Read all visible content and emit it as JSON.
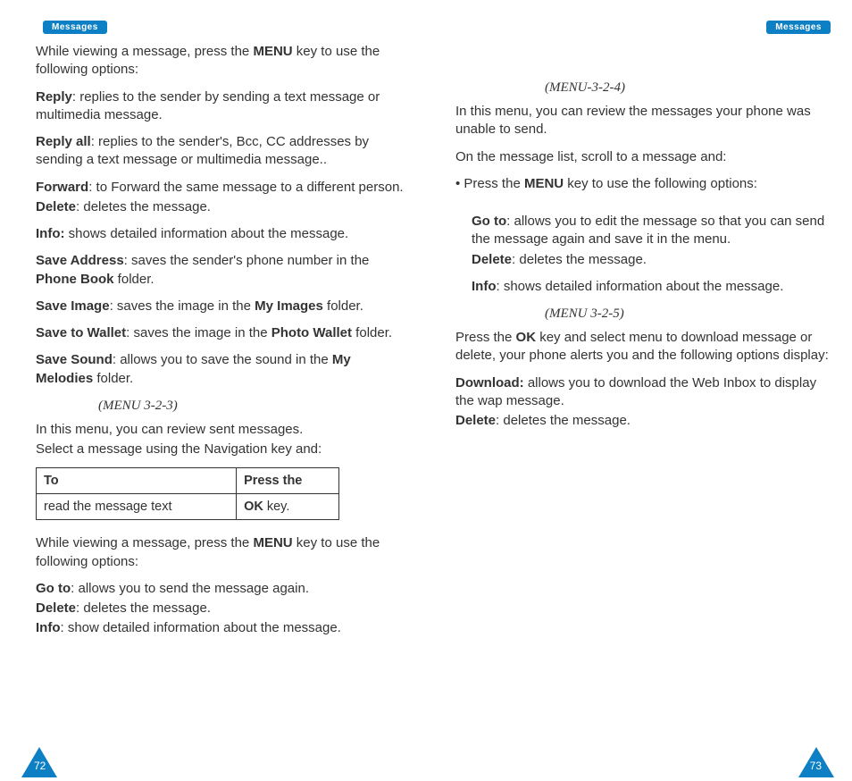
{
  "header": {
    "title": "Messages"
  },
  "pageNumbers": {
    "left": "72",
    "right": "73"
  },
  "left": {
    "intro": {
      "pre": "While viewing a message, press the ",
      "key": "MENU",
      "post": " key to use the following options:"
    },
    "opts": {
      "reply": {
        "label": "Reply",
        "text": ": replies to the sender by sending a text message or multimedia message."
      },
      "replyAll": {
        "label": "Reply all",
        "text": ": replies to the sender's, Bcc, CC addresses by sending a text message or multimedia message.."
      },
      "forward": {
        "label": "Forward",
        "text": ": to Forward the same message to a different person."
      },
      "delete": {
        "label": "Delete",
        "text": ": deletes the message."
      },
      "info": {
        "label": "Info:",
        "text": " shows detailed information about the message."
      },
      "saveAddr": {
        "label": "Save Address",
        "pre": ": saves the sender's phone number in the ",
        "bold": "Phone Book",
        "post": " folder."
      },
      "saveImage": {
        "label": "Save Image",
        "pre": ": saves the image in the ",
        "bold": "My Images",
        "post": " folder."
      },
      "saveWallet": {
        "label": "Save to Wallet",
        "pre": ": saves the image in the ",
        "bold": "Photo Wallet",
        "post": " folder."
      },
      "saveSound": {
        "label": "Save Sound",
        "pre": ": allows you to save the sound in the ",
        "bold": "My Melodies",
        "post": " folder."
      }
    },
    "menu323": "(MENU 3-2-3)",
    "sent1": "In this menu, you can review sent messages.",
    "sent2": "Select a message using the Navigation key and:",
    "table": {
      "h1": "To",
      "h2": "Press the",
      "c1": "read the message text",
      "c2_bold": "OK",
      "c2_post": " key."
    },
    "intro2": {
      "pre": "While viewing a message, press the ",
      "key": "MENU",
      "post": " key to use the following options:"
    },
    "opts2": {
      "goto": {
        "label": "Go to",
        "text": ": allows you to send the message again."
      },
      "delete": {
        "label": "Delete",
        "text": ": deletes the message."
      },
      "info": {
        "label": "Info",
        "text": ": show detailed information about the message."
      }
    }
  },
  "right": {
    "menu324": "(MENU-3-2-4)",
    "p1": "In this menu, you can review the messages your phone was unable to send.",
    "p2": "On the message list, scroll to a message and:",
    "bullet": {
      "pre": "• Press the ",
      "key": "MENU",
      "post": " key to use the following options:"
    },
    "opts": {
      "goto": {
        "label": "Go to",
        "text": ": allows you to edit the message so that you can send the message again and save it in the menu."
      },
      "delete": {
        "label": "Delete",
        "text": ": deletes the message."
      },
      "info": {
        "label": "Info",
        "text": ": shows detailed information about the message."
      }
    },
    "menu325": "(MENU 3-2-5)",
    "p3": {
      "pre": "Press the ",
      "key": "OK",
      "post": " key and select menu to download message or delete, your phone alerts you and the following options display:"
    },
    "opts2": {
      "download": {
        "label": "Download:",
        "text": " allows you to download the Web Inbox to display the wap message."
      },
      "delete": {
        "label": "Delete",
        "text": ": deletes the message."
      }
    }
  }
}
